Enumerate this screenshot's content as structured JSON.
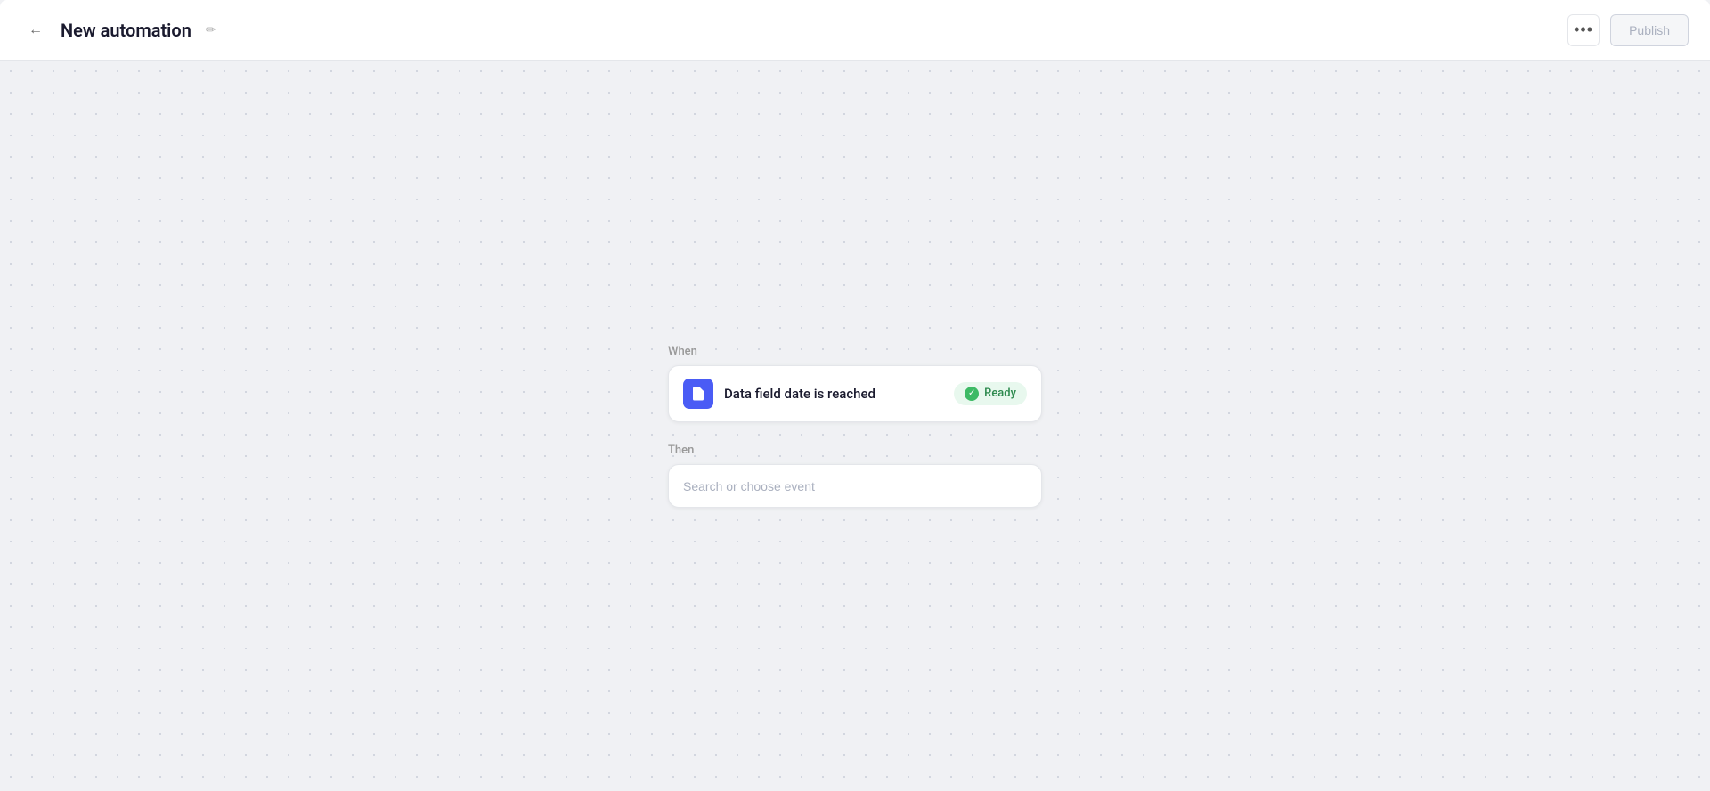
{
  "header": {
    "back_label": "←",
    "title": "New automation",
    "edit_icon": "✏",
    "more_icon": "•••",
    "publish_label": "Publish"
  },
  "flow": {
    "when_label": "When",
    "then_label": "Then",
    "trigger": {
      "label": "Data field date is reached",
      "status": "Ready"
    },
    "action": {
      "placeholder": "Search or choose event"
    }
  }
}
